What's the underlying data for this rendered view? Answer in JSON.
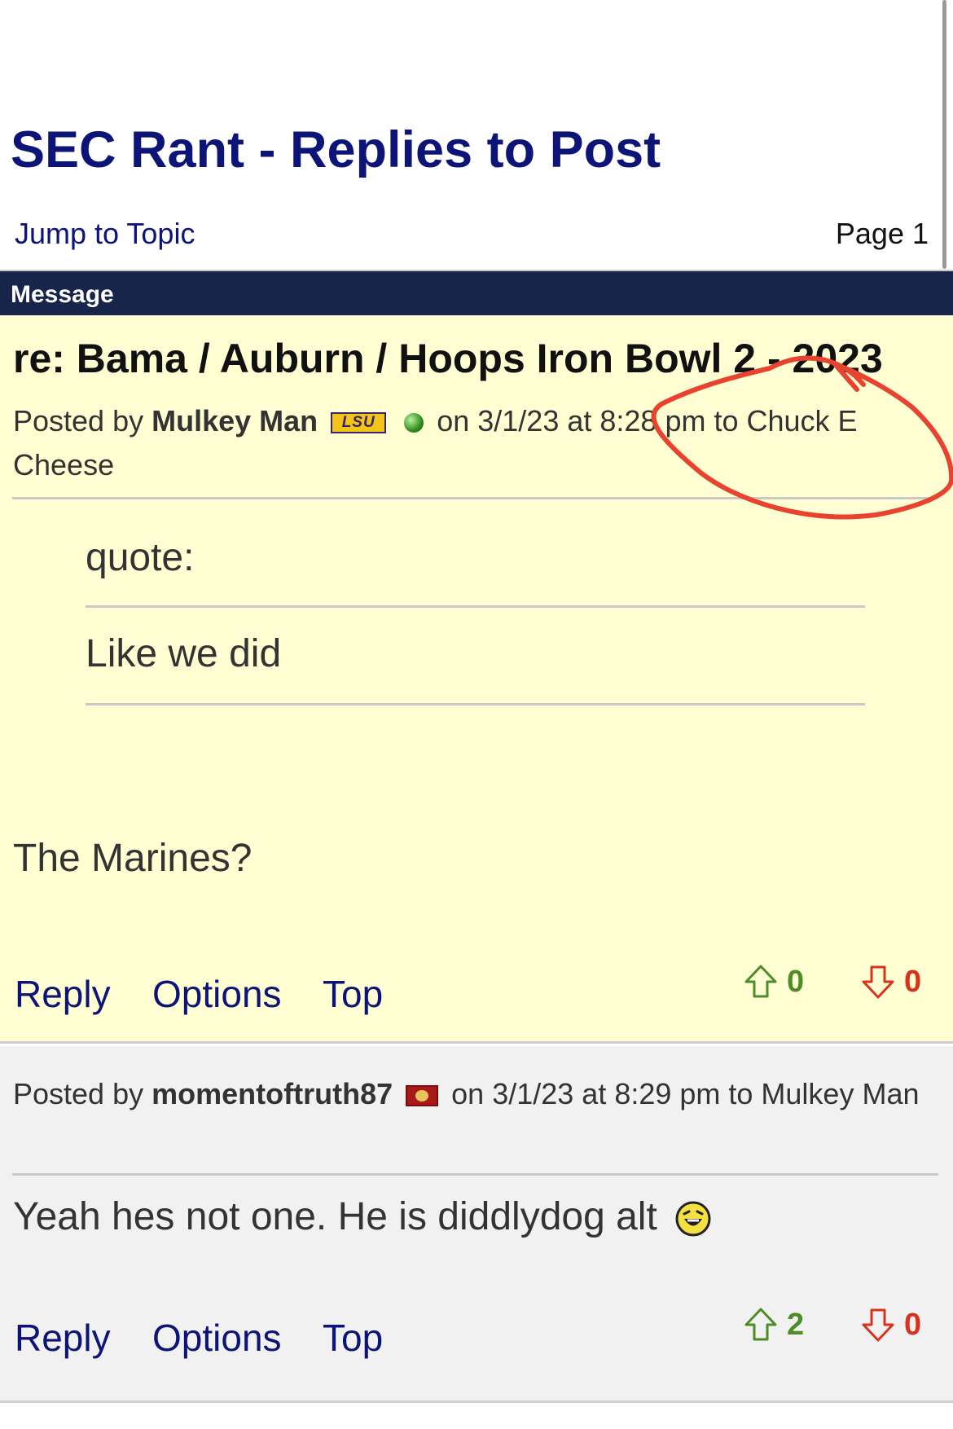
{
  "header": {
    "title": "SEC Rant - Replies to Post",
    "jump_label": "Jump to Topic",
    "page_label": "Page 1",
    "message_label": "Message"
  },
  "posts": [
    {
      "title": "re: Bama / Auburn / Hoops Iron Bowl 2 - 2023",
      "posted_by_prefix": "Posted by",
      "author": "Mulkey Man",
      "flair": "LSU",
      "status_icon": "green-online-dot",
      "meta_suffix": "on 3/1/23 at 8:28 pm to Chuck E Cheese",
      "quote_label": "quote:",
      "quote_text": "Like we did",
      "body": "The Marines?",
      "actions": {
        "reply": "Reply",
        "options": "Options",
        "top": "Top"
      },
      "upvotes": "0",
      "downvotes": "0"
    },
    {
      "posted_by_prefix": "Posted by",
      "author": "momentoftruth87",
      "flair": "usmc-flag-icon",
      "meta_suffix": "on 3/1/23 at 8:29 pm to Mulkey Man",
      "body": "Yeah hes not one. He is diddlydog alt",
      "emoji": "laughing-emoji-icon",
      "actions": {
        "reply": "Reply",
        "options": "Options",
        "top": "Top"
      },
      "upvotes": "2",
      "downvotes": "0"
    }
  ],
  "colors": {
    "link": "#0d1478",
    "header_bar": "#18254a",
    "post_highlight_bg": "#ffffd3",
    "post_bg": "#f1f1f1",
    "upvote": "#4e8c26",
    "downvote": "#d8321c",
    "annotation": "#e8432f"
  }
}
